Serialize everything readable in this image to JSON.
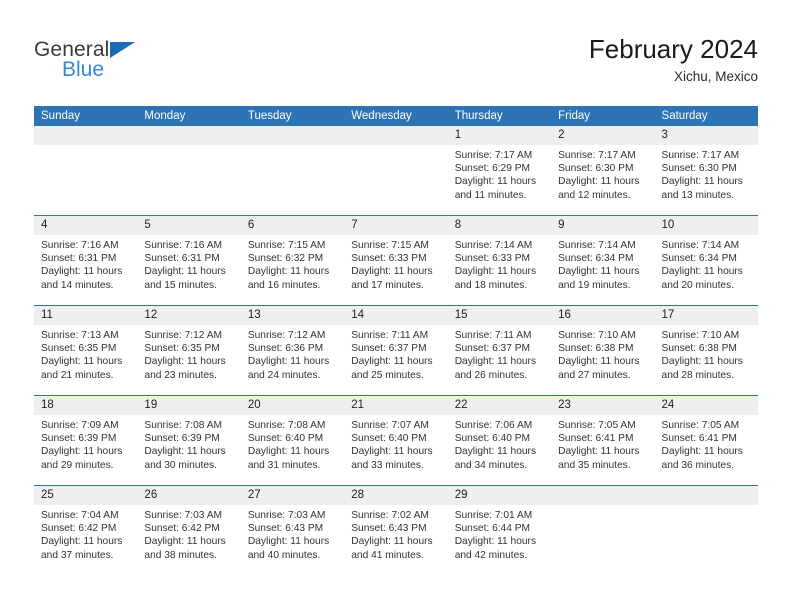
{
  "brand": {
    "name_top": "General",
    "name_bottom": "Blue",
    "triangle_color": "#1c6cb5",
    "blue_color": "#2e8bd6"
  },
  "header": {
    "title": "February 2024",
    "subtitle": "Xichu, Mexico"
  },
  "theme": {
    "header_blue": "#2e74b5",
    "date_band_gray": "#efefef",
    "text_color": "#333333"
  },
  "calendar": {
    "day_headers": [
      "Sunday",
      "Monday",
      "Tuesday",
      "Wednesday",
      "Thursday",
      "Friday",
      "Saturday"
    ],
    "weeks": [
      {
        "days": [
          {
            "num": "",
            "lines": [
              "",
              "",
              "",
              ""
            ]
          },
          {
            "num": "",
            "lines": [
              "",
              "",
              "",
              ""
            ]
          },
          {
            "num": "",
            "lines": [
              "",
              "",
              "",
              ""
            ]
          },
          {
            "num": "",
            "lines": [
              "",
              "",
              "",
              ""
            ]
          },
          {
            "num": "1",
            "lines": [
              "Sunrise: 7:17 AM",
              "Sunset: 6:29 PM",
              "Daylight: 11 hours",
              "and 11 minutes."
            ]
          },
          {
            "num": "2",
            "lines": [
              "Sunrise: 7:17 AM",
              "Sunset: 6:30 PM",
              "Daylight: 11 hours",
              "and 12 minutes."
            ]
          },
          {
            "num": "3",
            "lines": [
              "Sunrise: 7:17 AM",
              "Sunset: 6:30 PM",
              "Daylight: 11 hours",
              "and 13 minutes."
            ]
          }
        ]
      },
      {
        "days": [
          {
            "num": "4",
            "lines": [
              "Sunrise: 7:16 AM",
              "Sunset: 6:31 PM",
              "Daylight: 11 hours",
              "and 14 minutes."
            ]
          },
          {
            "num": "5",
            "lines": [
              "Sunrise: 7:16 AM",
              "Sunset: 6:31 PM",
              "Daylight: 11 hours",
              "and 15 minutes."
            ]
          },
          {
            "num": "6",
            "lines": [
              "Sunrise: 7:15 AM",
              "Sunset: 6:32 PM",
              "Daylight: 11 hours",
              "and 16 minutes."
            ]
          },
          {
            "num": "7",
            "lines": [
              "Sunrise: 7:15 AM",
              "Sunset: 6:33 PM",
              "Daylight: 11 hours",
              "and 17 minutes."
            ]
          },
          {
            "num": "8",
            "lines": [
              "Sunrise: 7:14 AM",
              "Sunset: 6:33 PM",
              "Daylight: 11 hours",
              "and 18 minutes."
            ]
          },
          {
            "num": "9",
            "lines": [
              "Sunrise: 7:14 AM",
              "Sunset: 6:34 PM",
              "Daylight: 11 hours",
              "and 19 minutes."
            ]
          },
          {
            "num": "10",
            "lines": [
              "Sunrise: 7:14 AM",
              "Sunset: 6:34 PM",
              "Daylight: 11 hours",
              "and 20 minutes."
            ]
          }
        ]
      },
      {
        "days": [
          {
            "num": "11",
            "lines": [
              "Sunrise: 7:13 AM",
              "Sunset: 6:35 PM",
              "Daylight: 11 hours",
              "and 21 minutes."
            ]
          },
          {
            "num": "12",
            "lines": [
              "Sunrise: 7:12 AM",
              "Sunset: 6:35 PM",
              "Daylight: 11 hours",
              "and 23 minutes."
            ]
          },
          {
            "num": "13",
            "lines": [
              "Sunrise: 7:12 AM",
              "Sunset: 6:36 PM",
              "Daylight: 11 hours",
              "and 24 minutes."
            ]
          },
          {
            "num": "14",
            "lines": [
              "Sunrise: 7:11 AM",
              "Sunset: 6:37 PM",
              "Daylight: 11 hours",
              "and 25 minutes."
            ]
          },
          {
            "num": "15",
            "lines": [
              "Sunrise: 7:11 AM",
              "Sunset: 6:37 PM",
              "Daylight: 11 hours",
              "and 26 minutes."
            ]
          },
          {
            "num": "16",
            "lines": [
              "Sunrise: 7:10 AM",
              "Sunset: 6:38 PM",
              "Daylight: 11 hours",
              "and 27 minutes."
            ]
          },
          {
            "num": "17",
            "lines": [
              "Sunrise: 7:10 AM",
              "Sunset: 6:38 PM",
              "Daylight: 11 hours",
              "and 28 minutes."
            ]
          }
        ]
      },
      {
        "days": [
          {
            "num": "18",
            "lines": [
              "Sunrise: 7:09 AM",
              "Sunset: 6:39 PM",
              "Daylight: 11 hours",
              "and 29 minutes."
            ]
          },
          {
            "num": "19",
            "lines": [
              "Sunrise: 7:08 AM",
              "Sunset: 6:39 PM",
              "Daylight: 11 hours",
              "and 30 minutes."
            ]
          },
          {
            "num": "20",
            "lines": [
              "Sunrise: 7:08 AM",
              "Sunset: 6:40 PM",
              "Daylight: 11 hours",
              "and 31 minutes."
            ]
          },
          {
            "num": "21",
            "lines": [
              "Sunrise: 7:07 AM",
              "Sunset: 6:40 PM",
              "Daylight: 11 hours",
              "and 33 minutes."
            ]
          },
          {
            "num": "22",
            "lines": [
              "Sunrise: 7:06 AM",
              "Sunset: 6:40 PM",
              "Daylight: 11 hours",
              "and 34 minutes."
            ]
          },
          {
            "num": "23",
            "lines": [
              "Sunrise: 7:05 AM",
              "Sunset: 6:41 PM",
              "Daylight: 11 hours",
              "and 35 minutes."
            ]
          },
          {
            "num": "24",
            "lines": [
              "Sunrise: 7:05 AM",
              "Sunset: 6:41 PM",
              "Daylight: 11 hours",
              "and 36 minutes."
            ]
          }
        ]
      },
      {
        "days": [
          {
            "num": "25",
            "lines": [
              "Sunrise: 7:04 AM",
              "Sunset: 6:42 PM",
              "Daylight: 11 hours",
              "and 37 minutes."
            ]
          },
          {
            "num": "26",
            "lines": [
              "Sunrise: 7:03 AM",
              "Sunset: 6:42 PM",
              "Daylight: 11 hours",
              "and 38 minutes."
            ]
          },
          {
            "num": "27",
            "lines": [
              "Sunrise: 7:03 AM",
              "Sunset: 6:43 PM",
              "Daylight: 11 hours",
              "and 40 minutes."
            ]
          },
          {
            "num": "28",
            "lines": [
              "Sunrise: 7:02 AM",
              "Sunset: 6:43 PM",
              "Daylight: 11 hours",
              "and 41 minutes."
            ]
          },
          {
            "num": "29",
            "lines": [
              "Sunrise: 7:01 AM",
              "Sunset: 6:44 PM",
              "Daylight: 11 hours",
              "and 42 minutes."
            ]
          },
          {
            "num": "",
            "lines": [
              "",
              "",
              "",
              ""
            ]
          },
          {
            "num": "",
            "lines": [
              "",
              "",
              "",
              ""
            ]
          }
        ]
      }
    ]
  }
}
